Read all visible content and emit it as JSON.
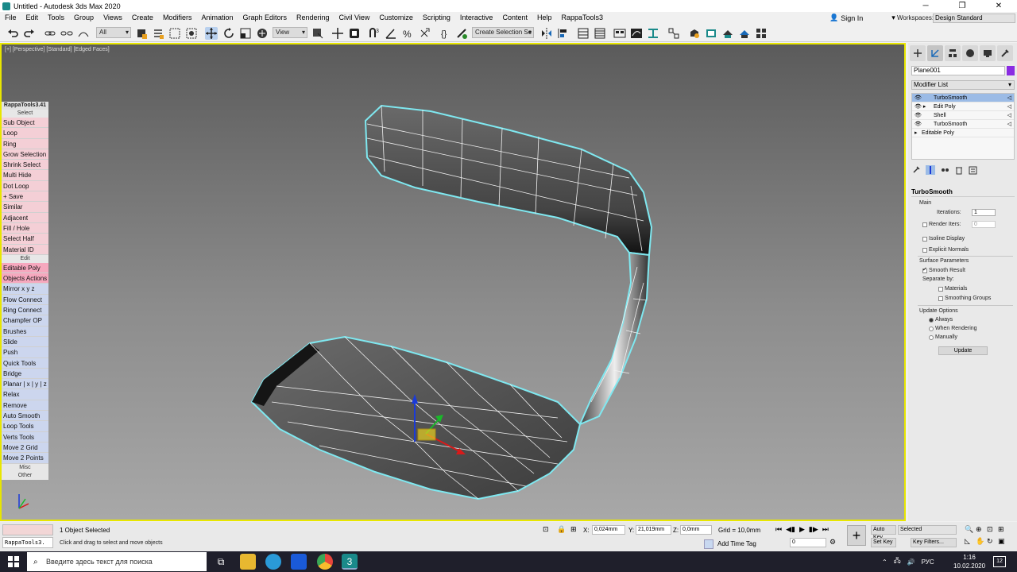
{
  "window": {
    "title": "Untitled - Autodesk 3ds Max 2020",
    "controls": [
      "─",
      "❐",
      "✕"
    ]
  },
  "menu": {
    "items": [
      "File",
      "Edit",
      "Tools",
      "Group",
      "Views",
      "Create",
      "Modifiers",
      "Animation",
      "Graph Editors",
      "Rendering",
      "Civil View",
      "Customize",
      "Scripting",
      "Interactive",
      "Content",
      "Help",
      "RappaTools3"
    ],
    "sign_in": "Sign In",
    "workspaces_label": "Workspaces:",
    "workspace_value": "Design Standard"
  },
  "toolbar": {
    "filter_value": "All",
    "refcoord_value": "View",
    "selection_set_placeholder": "Create Selection Se"
  },
  "viewport": {
    "label": "[+] [Perspective] [Standard] [Edged Faces]"
  },
  "rappatools": {
    "title": "RappaTools3.41",
    "sections": {
      "select": "Select",
      "edit": "Edit",
      "misc": "Misc",
      "other": "Other"
    },
    "select_buttons": [
      "Sub Object",
      "Loop",
      "Ring",
      "Grow Selection",
      "Shrink Select",
      "Multi Hide",
      "Dot Loop",
      "+ Save",
      "Similar",
      "Adjacent",
      "Fill / Hole",
      "Select Half",
      "Material ID"
    ],
    "edit_hot": [
      "Editable Poly",
      "Objects Actions"
    ],
    "edit_buttons": [
      "Mirror   x  y  z",
      "Flow Connect",
      "Ring Connect",
      "Champfer OP",
      "Brushes",
      "Slide",
      "Push",
      "Quick Tools",
      "Bridge",
      "Planar | x | y | z",
      "Relax",
      "Remove",
      "Auto Smooth",
      "Loop Tools",
      "Verts Tools",
      "Move 2 Grid",
      "Move 2 Points"
    ]
  },
  "command_panel": {
    "object_name": "Plane001",
    "object_color": "#8a2be2",
    "modifier_list_label": "Modifier List",
    "stack": [
      {
        "label": "TurboSmooth",
        "selected": true
      },
      {
        "label": "Edit Poly",
        "selected": false
      },
      {
        "label": "Shell",
        "selected": false
      },
      {
        "label": "TurboSmooth",
        "selected": false
      },
      {
        "label": "Editable Poly",
        "selected": false
      }
    ],
    "turbosmooth": {
      "title": "TurboSmooth",
      "main_label": "Main",
      "iterations_label": "Iterations:",
      "iterations_value": "1",
      "render_iters_label": "Render Iters:",
      "render_iters_value": "0",
      "isoline_display": "Isoline Display",
      "explicit_normals": "Explicit Normals",
      "surface_params": "Surface Parameters",
      "smooth_result": "Smooth Result",
      "separate_by": "Separate by:",
      "materials": "Materials",
      "smoothing_groups": "Smoothing Groups",
      "update_options": "Update Options",
      "always": "Always",
      "when_rendering": "When Rendering",
      "manually": "Manually",
      "update_button": "Update"
    }
  },
  "status": {
    "maxscript_text": "RappaTools3.",
    "selection_status": "1 Object Selected",
    "prompt": "Click and drag to select and move objects",
    "x_label": "X:",
    "x_value": "0,024mm",
    "y_label": "Y:",
    "y_value": "21,019mm",
    "z_label": "Z:",
    "z_value": "0,0mm",
    "grid": "Grid = 10,0mm",
    "add_time_tag": "Add Time Tag",
    "frame_value": "0",
    "auto_key": "Auto Key",
    "set_key": "Set Key",
    "selected_value": "Selected",
    "key_filters": "Key Filters..."
  },
  "taskbar": {
    "search_placeholder": "Введите здесь текст для поиска",
    "lang": "РУС",
    "time": "1:16",
    "date": "10.02.2020",
    "notifications": "12"
  }
}
